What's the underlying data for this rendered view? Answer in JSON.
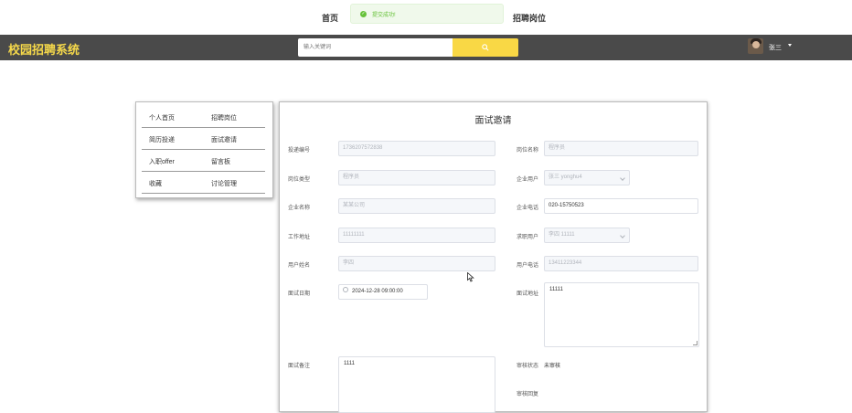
{
  "topnav": {
    "home": "首页",
    "jobs": "招聘岗位",
    "toast": "提交成功!"
  },
  "header": {
    "logo": "校园招聘系统",
    "search_placeholder": "输入关键词",
    "username": "张三"
  },
  "sidemenu": {
    "rows": [
      [
        "个人首页",
        "招聘岗位"
      ],
      [
        "简历投递",
        "面试邀请"
      ],
      [
        "入职offer",
        "留言板"
      ],
      [
        "收藏",
        "讨论管理"
      ]
    ]
  },
  "form": {
    "title": "面试邀请",
    "fields": {
      "report_no": {
        "label": "投递编号",
        "value": "1736207572838"
      },
      "job_name": {
        "label": "岗位名称",
        "value": "程序员"
      },
      "job_type": {
        "label": "岗位类型",
        "value": "程序员"
      },
      "company_user": {
        "label": "企业用户",
        "value": "张三 yonghu4"
      },
      "company_name": {
        "label": "企业名称",
        "value": "某某公司"
      },
      "company_phone": {
        "label": "企业电话",
        "value": "020-15750523"
      },
      "work_address": {
        "label": "工作地址",
        "value": "11111111"
      },
      "applicant_user": {
        "label": "求职用户",
        "value": "李四 11111"
      },
      "user_name": {
        "label": "用户姓名",
        "value": "李四"
      },
      "user_phone": {
        "label": "用户电话",
        "value": "13411223344"
      },
      "interview_date": {
        "label": "面试日期",
        "value": "2024-12-28 09:00:00"
      },
      "interview_address": {
        "label": "面试地址",
        "value": "11111"
      },
      "interview_note": {
        "label": "面试备注",
        "value": "1111"
      },
      "review_status": {
        "label": "审核状态",
        "value": "未审核"
      },
      "review_reply": {
        "label": "审核回复",
        "value": ""
      }
    }
  }
}
